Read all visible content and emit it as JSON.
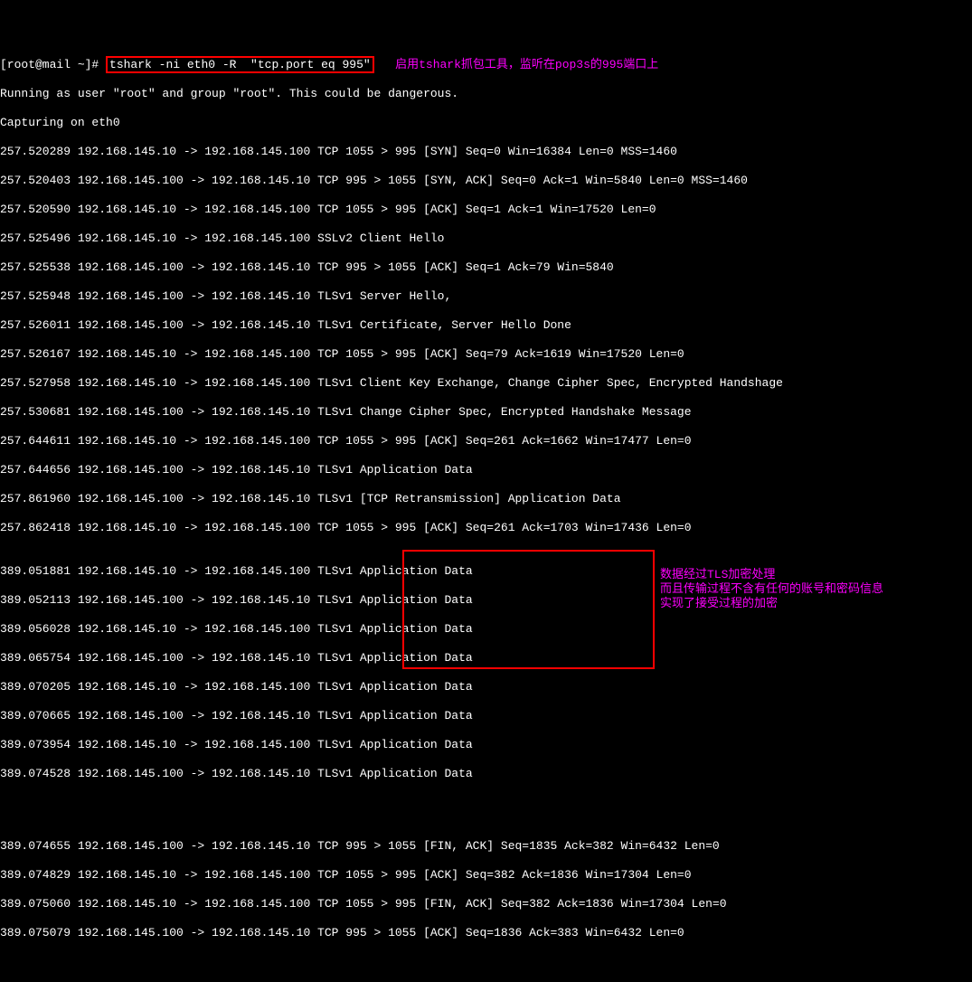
{
  "prompt": {
    "text": "[root@mail ~]# ",
    "command": "tshark -ni eth0 -R  \"tcp.port eq 995\"",
    "annotation": "   启用tshark抓包工具，监听在pop3s的995端口上"
  },
  "lines": [
    "Running as user \"root\" and group \"root\". This could be dangerous.",
    "Capturing on eth0",
    "257.520289 192.168.145.10 -> 192.168.145.100 TCP 1055 > 995 [SYN] Seq=0 Win=16384 Len=0 MSS=1460",
    "257.520403 192.168.145.100 -> 192.168.145.10 TCP 995 > 1055 [SYN, ACK] Seq=0 Ack=1 Win=5840 Len=0 MSS=1460",
    "257.520590 192.168.145.10 -> 192.168.145.100 TCP 1055 > 995 [ACK] Seq=1 Ack=1 Win=17520 Len=0",
    "257.525496 192.168.145.10 -> 192.168.145.100 SSLv2 Client Hello",
    "257.525538 192.168.145.100 -> 192.168.145.10 TCP 995 > 1055 [ACK] Seq=1 Ack=79 Win=5840",
    "257.525948 192.168.145.100 -> 192.168.145.10 TLSv1 Server Hello,",
    "257.526011 192.168.145.100 -> 192.168.145.10 TLSv1 Certificate, Server Hello Done",
    "257.526167 192.168.145.10 -> 192.168.145.100 TCP 1055 > 995 [ACK] Seq=79 Ack=1619 Win=17520 Len=0",
    "257.527958 192.168.145.10 -> 192.168.145.100 TLSv1 Client Key Exchange, Change Cipher Spec, Encrypted Handshage",
    "257.530681 192.168.145.100 -> 192.168.145.10 TLSv1 Change Cipher Spec, Encrypted Handshake Message",
    "257.644611 192.168.145.10 -> 192.168.145.100 TCP 1055 > 995 [ACK] Seq=261 Ack=1662 Win=17477 Len=0",
    "257.644656 192.168.145.100 -> 192.168.145.10 TLSv1 Application Data",
    "257.861960 192.168.145.100 -> 192.168.145.10 TLSv1 [TCP Retransmission] Application Data",
    "257.862418 192.168.145.10 -> 192.168.145.100 TCP 1055 > 995 [ACK] Seq=261 Ack=1703 Win=17436 Len=0"
  ],
  "highlighted": [
    "389.051881 192.168.145.10 -> 192.168.145.100 TLSv1 Application Data",
    "389.052113 192.168.145.100 -> 192.168.145.10 TLSv1 Application Data",
    "389.056028 192.168.145.10 -> 192.168.145.100 TLSv1 Application Data",
    "389.065754 192.168.145.100 -> 192.168.145.10 TLSv1 Application Data",
    "389.070205 192.168.145.10 -> 192.168.145.100 TLSv1 Application Data",
    "389.070665 192.168.145.100 -> 192.168.145.10 TLSv1 Application Data",
    "389.073954 192.168.145.10 -> 192.168.145.100 TLSv1 Application Data",
    "389.074528 192.168.145.100 -> 192.168.145.10 TLSv1 Application Data"
  ],
  "annotation2": "数据经过TLS加密处理\n而且传输过程不含有任何的账号和密码信息\n实现了接受过程的加密",
  "tail": [
    "389.074655 192.168.145.100 -> 192.168.145.10 TCP 995 > 1055 [FIN, ACK] Seq=1835 Ack=382 Win=6432 Len=0",
    "389.074829 192.168.145.10 -> 192.168.145.100 TCP 1055 > 995 [ACK] Seq=382 Ack=1836 Win=17304 Len=0",
    "389.075060 192.168.145.10 -> 192.168.145.100 TCP 1055 > 995 [FIN, ACK] Seq=382 Ack=1836 Win=17304 Len=0",
    "389.075079 192.168.145.100 -> 192.168.145.10 TCP 995 > 1055 [ACK] Seq=1836 Ack=383 Win=6432 Len=0"
  ]
}
